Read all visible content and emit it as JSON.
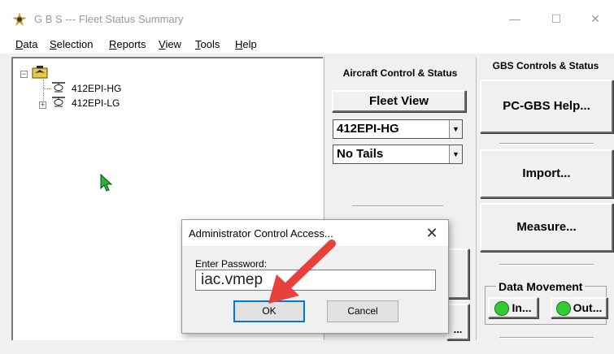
{
  "window": {
    "title": "G B S --- Fleet Status Summary",
    "controls": {
      "minimize": "—",
      "maximize": "☐",
      "close": "✕"
    }
  },
  "menu": {
    "items": [
      "Data",
      "Selection",
      "Reports",
      "View",
      "Tools",
      "Help"
    ]
  },
  "tree": {
    "nodes": [
      {
        "label": "412EPI-HG",
        "expandable": false
      },
      {
        "label": "412EPI-LG",
        "expandable": true
      }
    ]
  },
  "aircraft_panel": {
    "header": "Aircraft Control & Status",
    "fleet_view_label": "Fleet View",
    "aircraft_select": {
      "value": "412EPI-HG"
    },
    "tails_select": {
      "value": "No Tails"
    },
    "partial_button_label": "..."
  },
  "gbs_panel": {
    "header": "GBS Controls & Status",
    "help_label": "PC-GBS Help...",
    "import_label": "Import...",
    "measure_label": "Measure...",
    "data_movement": {
      "title": "Data Movement",
      "in_label": "In...",
      "out_label": "Out..."
    }
  },
  "dialog": {
    "title": "Administrator Control Access...",
    "close_glyph": "✕",
    "password_label": "Enter Password:",
    "password_value": "iac.vmep",
    "ok_label": "OK",
    "cancel_label": "Cancel"
  },
  "colors": {
    "accent_focus": "#0078d7",
    "annotation_arrow": "#e8403b",
    "led_green": "#33cc33",
    "cursor_green": "#2fae3a"
  },
  "icons": [
    "app-icon",
    "aircraft-icon",
    "helicopter-icon",
    "cursor-icon",
    "arrow-annotation-icon",
    "dropdown-arrow-icon"
  ]
}
